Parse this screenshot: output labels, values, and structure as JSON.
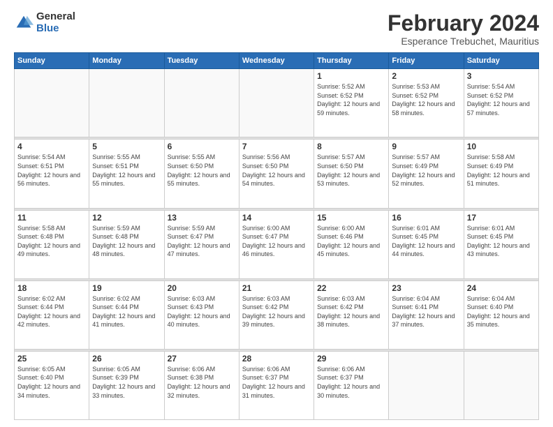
{
  "logo": {
    "general": "General",
    "blue": "Blue"
  },
  "header": {
    "month": "February 2024",
    "location": "Esperance Trebuchet, Mauritius"
  },
  "weekdays": [
    "Sunday",
    "Monday",
    "Tuesday",
    "Wednesday",
    "Thursday",
    "Friday",
    "Saturday"
  ],
  "weeks": [
    [
      {
        "day": "",
        "sunrise": "",
        "sunset": "",
        "daylight": ""
      },
      {
        "day": "",
        "sunrise": "",
        "sunset": "",
        "daylight": ""
      },
      {
        "day": "",
        "sunrise": "",
        "sunset": "",
        "daylight": ""
      },
      {
        "day": "",
        "sunrise": "",
        "sunset": "",
        "daylight": ""
      },
      {
        "day": "1",
        "sunrise": "Sunrise: 5:52 AM",
        "sunset": "Sunset: 6:52 PM",
        "daylight": "Daylight: 12 hours and 59 minutes."
      },
      {
        "day": "2",
        "sunrise": "Sunrise: 5:53 AM",
        "sunset": "Sunset: 6:52 PM",
        "daylight": "Daylight: 12 hours and 58 minutes."
      },
      {
        "day": "3",
        "sunrise": "Sunrise: 5:54 AM",
        "sunset": "Sunset: 6:52 PM",
        "daylight": "Daylight: 12 hours and 57 minutes."
      }
    ],
    [
      {
        "day": "4",
        "sunrise": "Sunrise: 5:54 AM",
        "sunset": "Sunset: 6:51 PM",
        "daylight": "Daylight: 12 hours and 56 minutes."
      },
      {
        "day": "5",
        "sunrise": "Sunrise: 5:55 AM",
        "sunset": "Sunset: 6:51 PM",
        "daylight": "Daylight: 12 hours and 55 minutes."
      },
      {
        "day": "6",
        "sunrise": "Sunrise: 5:55 AM",
        "sunset": "Sunset: 6:50 PM",
        "daylight": "Daylight: 12 hours and 55 minutes."
      },
      {
        "day": "7",
        "sunrise": "Sunrise: 5:56 AM",
        "sunset": "Sunset: 6:50 PM",
        "daylight": "Daylight: 12 hours and 54 minutes."
      },
      {
        "day": "8",
        "sunrise": "Sunrise: 5:57 AM",
        "sunset": "Sunset: 6:50 PM",
        "daylight": "Daylight: 12 hours and 53 minutes."
      },
      {
        "day": "9",
        "sunrise": "Sunrise: 5:57 AM",
        "sunset": "Sunset: 6:49 PM",
        "daylight": "Daylight: 12 hours and 52 minutes."
      },
      {
        "day": "10",
        "sunrise": "Sunrise: 5:58 AM",
        "sunset": "Sunset: 6:49 PM",
        "daylight": "Daylight: 12 hours and 51 minutes."
      }
    ],
    [
      {
        "day": "11",
        "sunrise": "Sunrise: 5:58 AM",
        "sunset": "Sunset: 6:48 PM",
        "daylight": "Daylight: 12 hours and 49 minutes."
      },
      {
        "day": "12",
        "sunrise": "Sunrise: 5:59 AM",
        "sunset": "Sunset: 6:48 PM",
        "daylight": "Daylight: 12 hours and 48 minutes."
      },
      {
        "day": "13",
        "sunrise": "Sunrise: 5:59 AM",
        "sunset": "Sunset: 6:47 PM",
        "daylight": "Daylight: 12 hours and 47 minutes."
      },
      {
        "day": "14",
        "sunrise": "Sunrise: 6:00 AM",
        "sunset": "Sunset: 6:47 PM",
        "daylight": "Daylight: 12 hours and 46 minutes."
      },
      {
        "day": "15",
        "sunrise": "Sunrise: 6:00 AM",
        "sunset": "Sunset: 6:46 PM",
        "daylight": "Daylight: 12 hours and 45 minutes."
      },
      {
        "day": "16",
        "sunrise": "Sunrise: 6:01 AM",
        "sunset": "Sunset: 6:45 PM",
        "daylight": "Daylight: 12 hours and 44 minutes."
      },
      {
        "day": "17",
        "sunrise": "Sunrise: 6:01 AM",
        "sunset": "Sunset: 6:45 PM",
        "daylight": "Daylight: 12 hours and 43 minutes."
      }
    ],
    [
      {
        "day": "18",
        "sunrise": "Sunrise: 6:02 AM",
        "sunset": "Sunset: 6:44 PM",
        "daylight": "Daylight: 12 hours and 42 minutes."
      },
      {
        "day": "19",
        "sunrise": "Sunrise: 6:02 AM",
        "sunset": "Sunset: 6:44 PM",
        "daylight": "Daylight: 12 hours and 41 minutes."
      },
      {
        "day": "20",
        "sunrise": "Sunrise: 6:03 AM",
        "sunset": "Sunset: 6:43 PM",
        "daylight": "Daylight: 12 hours and 40 minutes."
      },
      {
        "day": "21",
        "sunrise": "Sunrise: 6:03 AM",
        "sunset": "Sunset: 6:42 PM",
        "daylight": "Daylight: 12 hours and 39 minutes."
      },
      {
        "day": "22",
        "sunrise": "Sunrise: 6:03 AM",
        "sunset": "Sunset: 6:42 PM",
        "daylight": "Daylight: 12 hours and 38 minutes."
      },
      {
        "day": "23",
        "sunrise": "Sunrise: 6:04 AM",
        "sunset": "Sunset: 6:41 PM",
        "daylight": "Daylight: 12 hours and 37 minutes."
      },
      {
        "day": "24",
        "sunrise": "Sunrise: 6:04 AM",
        "sunset": "Sunset: 6:40 PM",
        "daylight": "Daylight: 12 hours and 35 minutes."
      }
    ],
    [
      {
        "day": "25",
        "sunrise": "Sunrise: 6:05 AM",
        "sunset": "Sunset: 6:40 PM",
        "daylight": "Daylight: 12 hours and 34 minutes."
      },
      {
        "day": "26",
        "sunrise": "Sunrise: 6:05 AM",
        "sunset": "Sunset: 6:39 PM",
        "daylight": "Daylight: 12 hours and 33 minutes."
      },
      {
        "day": "27",
        "sunrise": "Sunrise: 6:06 AM",
        "sunset": "Sunset: 6:38 PM",
        "daylight": "Daylight: 12 hours and 32 minutes."
      },
      {
        "day": "28",
        "sunrise": "Sunrise: 6:06 AM",
        "sunset": "Sunset: 6:37 PM",
        "daylight": "Daylight: 12 hours and 31 minutes."
      },
      {
        "day": "29",
        "sunrise": "Sunrise: 6:06 AM",
        "sunset": "Sunset: 6:37 PM",
        "daylight": "Daylight: 12 hours and 30 minutes."
      },
      {
        "day": "",
        "sunrise": "",
        "sunset": "",
        "daylight": ""
      },
      {
        "day": "",
        "sunrise": "",
        "sunset": "",
        "daylight": ""
      }
    ]
  ]
}
